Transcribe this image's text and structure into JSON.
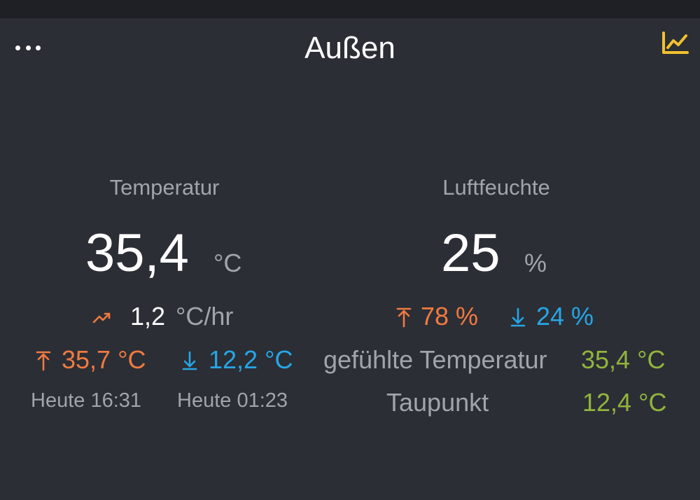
{
  "header": {
    "title": "Außen",
    "more_icon": "more-horizontal-icon",
    "chart_icon": "line-chart-icon",
    "accent_color": "#f2c12e"
  },
  "temperature": {
    "label": "Temperatur",
    "value": "35,4",
    "unit": "°C",
    "trend_icon": "trending-up-icon",
    "trend_value": "1,2",
    "trend_unit": "°C/hr",
    "max_value": "35,7 °C",
    "min_value": "12,2 °C",
    "max_time": "Heute 16:31",
    "min_time": "Heute 01:23"
  },
  "humidity": {
    "label": "Luftfeuchte",
    "value": "25",
    "unit": "%",
    "max_value": "78 %",
    "min_value": "24 %"
  },
  "derived": {
    "feels_like_label": "gefühlte Temperatur",
    "feels_like_value": "35,4 °C",
    "dewpoint_label": "Taupunkt",
    "dewpoint_value": "12,4 °C"
  },
  "colors": {
    "background": "#2b2e35",
    "max": "#f17a40",
    "min": "#26a6e6",
    "derived": "#93b43c"
  }
}
